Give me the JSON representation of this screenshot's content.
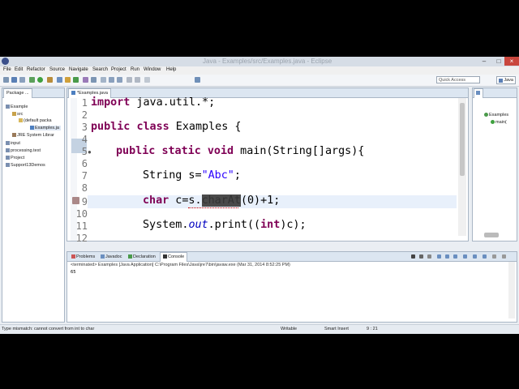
{
  "window": {
    "title": "Java - Examples/src/Examples.java - Eclipse"
  },
  "menu": [
    "File",
    "Edit",
    "Refactor",
    "Source",
    "Navigate",
    "Search",
    "Project",
    "Run",
    "Window",
    "Help"
  ],
  "quick_access": "Quick Access",
  "perspective": "Java",
  "package_explorer": {
    "tab": "Package ...",
    "items": [
      {
        "label": "Example",
        "icon": "project-icon"
      },
      {
        "label": "src",
        "icon": "folder-icon"
      },
      {
        "label": "(default packa",
        "icon": "package-icon"
      },
      {
        "label": "Examples.ja",
        "icon": "java-file-icon"
      },
      {
        "label": "JRE System Librar",
        "icon": "library-icon"
      },
      {
        "label": "input",
        "icon": "project-icon"
      },
      {
        "label": "processing.test",
        "icon": "project-icon"
      },
      {
        "label": "Project",
        "icon": "project-icon"
      },
      {
        "label": "Support13Demos",
        "icon": "project-icon"
      }
    ]
  },
  "editor": {
    "tab": "*Examples.java",
    "line_numbers": [
      "1",
      "2",
      "3",
      "4",
      "5",
      "6",
      "7",
      "8",
      "9",
      "10",
      "11",
      "12"
    ],
    "lines": {
      "l1_kw": "import",
      "l1_rest": " java.util.*;",
      "l3_kw1": "public",
      "l3_kw2": "class",
      "l3_rest": " Examples {",
      "l5_kw1": "public",
      "l5_kw2": "static",
      "l5_kw3": "void",
      "l5_rest": " main(String[]args){",
      "l7_a": "String s=",
      "l7_str": "\"Abc\"",
      "l7_b": ";",
      "l9_kw": "char",
      "l9_a": " c=s.",
      "l9_sel": "charAt",
      "l9_b": "(0)+1;",
      "l11_a": "System.",
      "l11_it": "out",
      "l11_b": ".print((",
      "l11_kw": "int",
      "l11_c": ")c);"
    }
  },
  "outline": {
    "items": [
      "Examples",
      "main("
    ]
  },
  "bottom": {
    "tabs": [
      "Problems",
      "Javadoc",
      "Declaration",
      "Console"
    ],
    "terminated": "<terminated> Examples [Java Application] C:\\Program Files\\Java\\jre7\\bin\\javaw.exe (Mar 31, 2014 8:52:25 PM)",
    "output": "65"
  },
  "status": {
    "message": "Type mismatch: cannot convert from int to char",
    "writable": "Writable",
    "insert": "Smart Insert",
    "position": "9 : 21"
  }
}
